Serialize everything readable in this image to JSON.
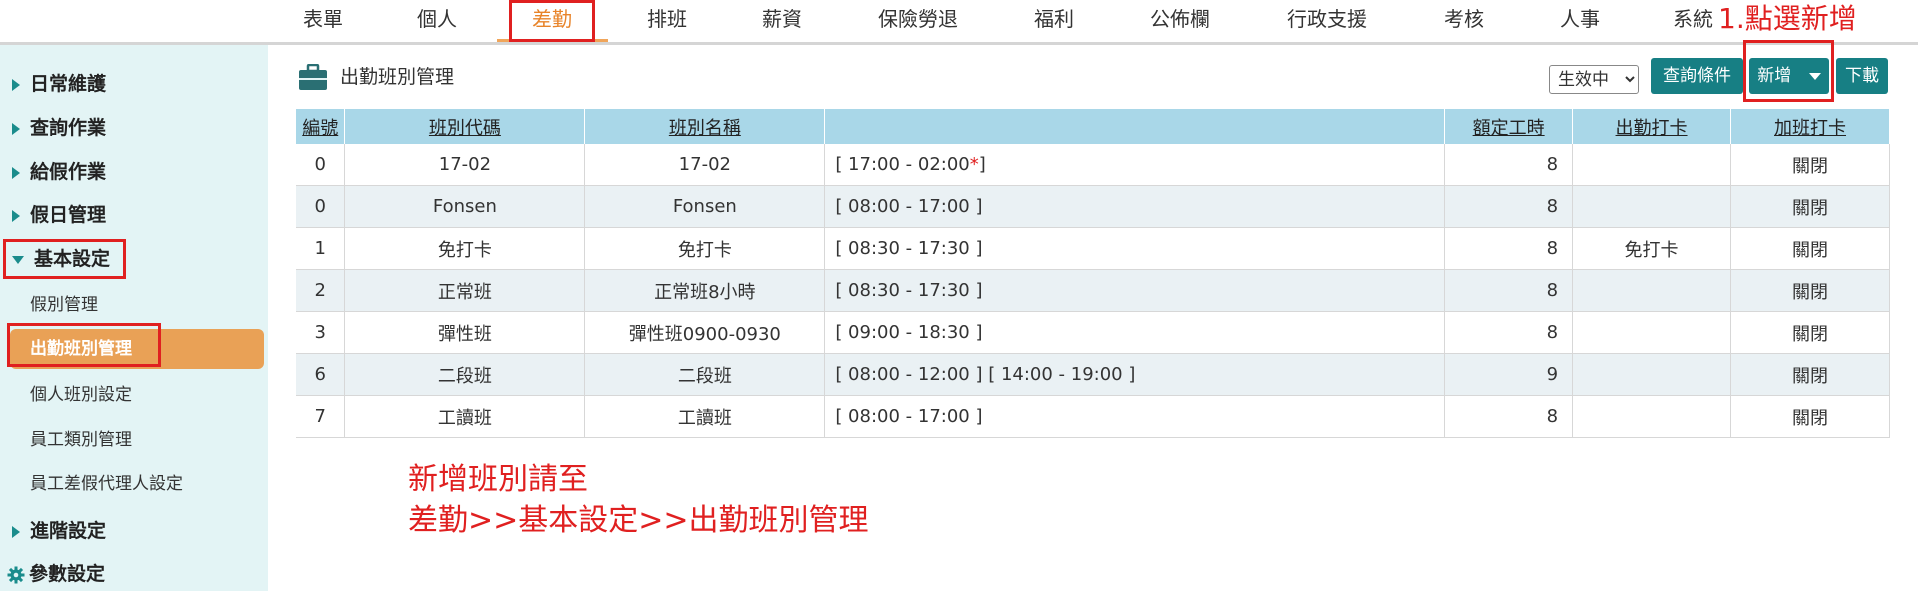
{
  "topnav": {
    "items": [
      "表單",
      "個人",
      "差勤",
      "排班",
      "薪資",
      "保險勞退",
      "福利",
      "公佈欄",
      "行政支援",
      "考核",
      "人事",
      "系統"
    ],
    "active_index": 2
  },
  "annotations": {
    "step1": "1.點選新增",
    "note_line1": "新增班別請至",
    "note_line2": "差勤>>基本設定>>出勤班別管理"
  },
  "sidebar": {
    "groups": [
      "日常維護",
      "查詢作業",
      "給假作業",
      "假日管理",
      "基本設定"
    ],
    "expanded_group": "基本設定",
    "sub_items": [
      "假別管理",
      "出勤班別管理",
      "個人班別設定",
      "員工類別管理",
      "員工差假代理人設定"
    ],
    "selected_sub": "出勤班別管理",
    "after_groups": [
      "進階設定",
      "參數設定"
    ]
  },
  "page": {
    "title": "出勤班別管理",
    "status_filter": "生效中",
    "buttons": {
      "query": "查詢條件",
      "add": "新增",
      "download": "下載"
    }
  },
  "table": {
    "headers": [
      "編號",
      "班別代碼",
      "班別名稱",
      "",
      "額定工時",
      "出勤打卡",
      "加班打卡"
    ],
    "rows": [
      {
        "no": "0",
        "code": "17-02",
        "name": "17-02",
        "time": "[  17:00  -  02:00",
        "time_mark": "*",
        "time_end": "]",
        "hours": "8",
        "clock": "",
        "ot_clock": "關閉"
      },
      {
        "no": "0",
        "code": "Fonsen",
        "name": "Fonsen",
        "time": "[  08:00  -  17:00  ]",
        "time_mark": "",
        "time_end": "",
        "hours": "8",
        "clock": "",
        "ot_clock": "關閉"
      },
      {
        "no": "1",
        "code": "免打卡",
        "name": "免打卡",
        "time": "[  08:30  -  17:30  ]",
        "time_mark": "",
        "time_end": "",
        "hours": "8",
        "clock": "免打卡",
        "ot_clock": "關閉"
      },
      {
        "no": "2",
        "code": "正常班",
        "name": "正常班8小時",
        "time": "[  08:30  -  17:30  ]",
        "time_mark": "",
        "time_end": "",
        "hours": "8",
        "clock": "",
        "ot_clock": "關閉"
      },
      {
        "no": "3",
        "code": "彈性班",
        "name": "彈性班0900-0930",
        "time": "[  09:00  -  18:30  ]",
        "time_mark": "",
        "time_end": "",
        "hours": "8",
        "clock": "",
        "ot_clock": "關閉"
      },
      {
        "no": "6",
        "code": "二段班",
        "name": "二段班",
        "time": "[  08:00  -  12:00  ] [  14:00  -  19:00  ]",
        "time_mark": "",
        "time_end": "",
        "hours": "9",
        "clock": "",
        "ot_clock": "關閉"
      },
      {
        "no": "7",
        "code": "工讀班",
        "name": "工讀班",
        "time": "[  08:00  -  17:00  ]",
        "time_mark": "",
        "time_end": "",
        "hours": "8",
        "clock": "",
        "ot_clock": "關閉"
      }
    ]
  },
  "colors": {
    "accent_orange": "#e9a156",
    "teal_button": "#177f84",
    "table_header": "#a9d7e8",
    "sidebar_bg": "#e3f4f5",
    "annotation_red": "#e02020"
  }
}
